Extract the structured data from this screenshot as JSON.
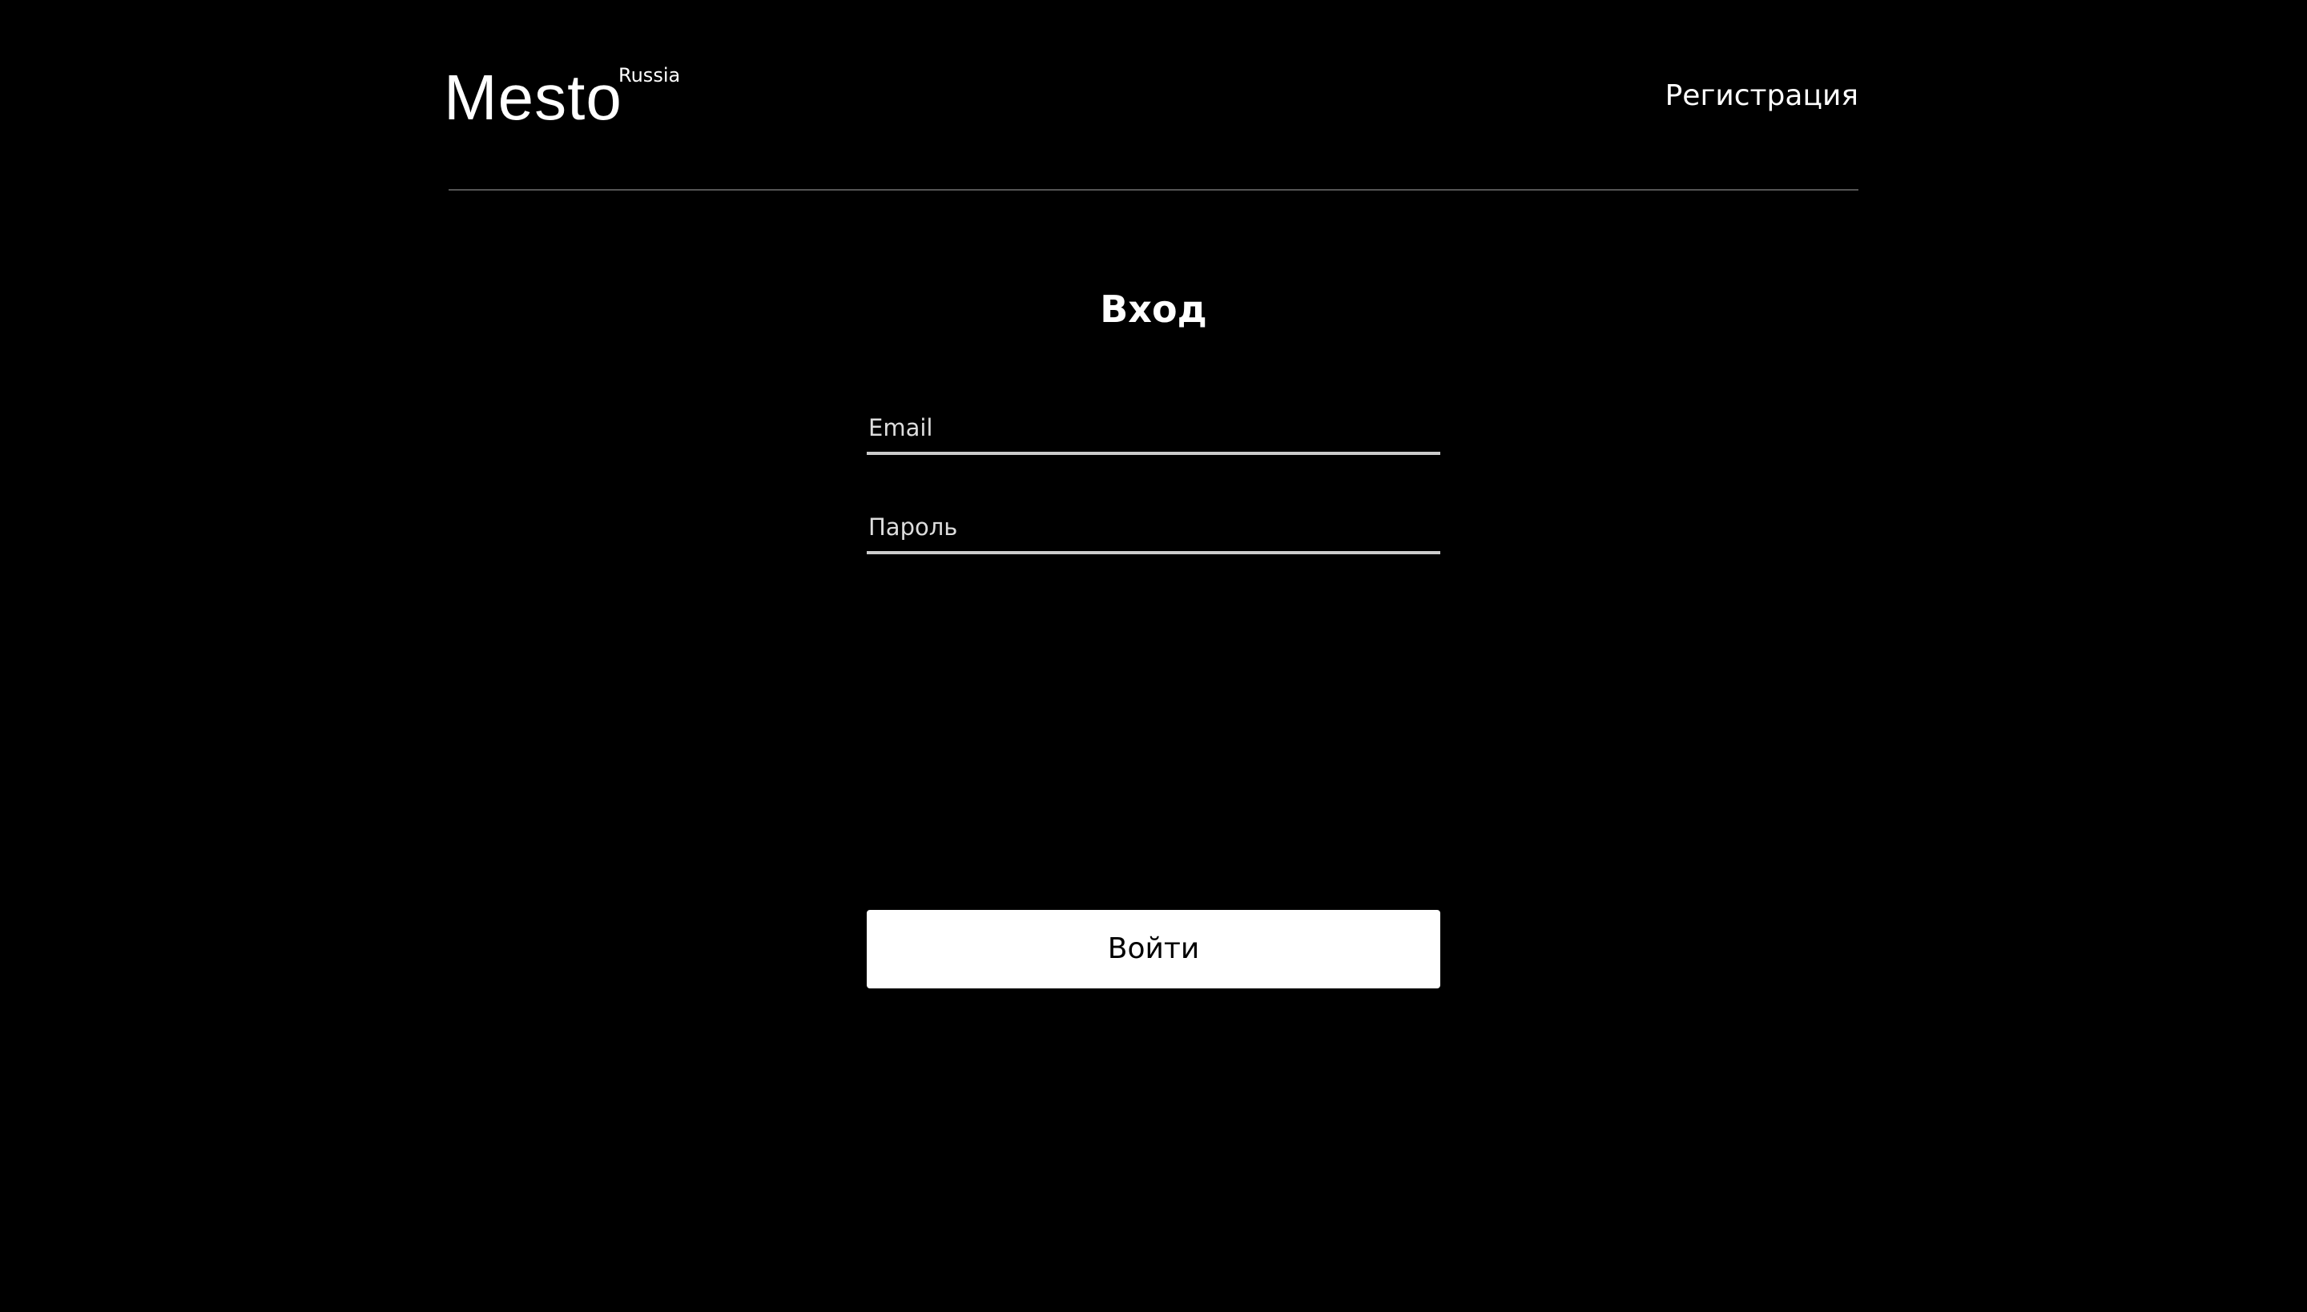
{
  "header": {
    "logo_text": "Mesto",
    "logo_superscript": "Russia",
    "register_link": "Регистрация"
  },
  "login": {
    "title": "Вход",
    "email": {
      "value": "",
      "placeholder": "Email"
    },
    "password": {
      "value": "",
      "placeholder": "Пароль"
    },
    "submit_label": "Войти"
  },
  "colors": {
    "background": "#000000",
    "text": "#ffffff",
    "divider": "#545454",
    "input_underline": "#cccccc",
    "button_background": "#ffffff",
    "button_text": "#000000"
  }
}
